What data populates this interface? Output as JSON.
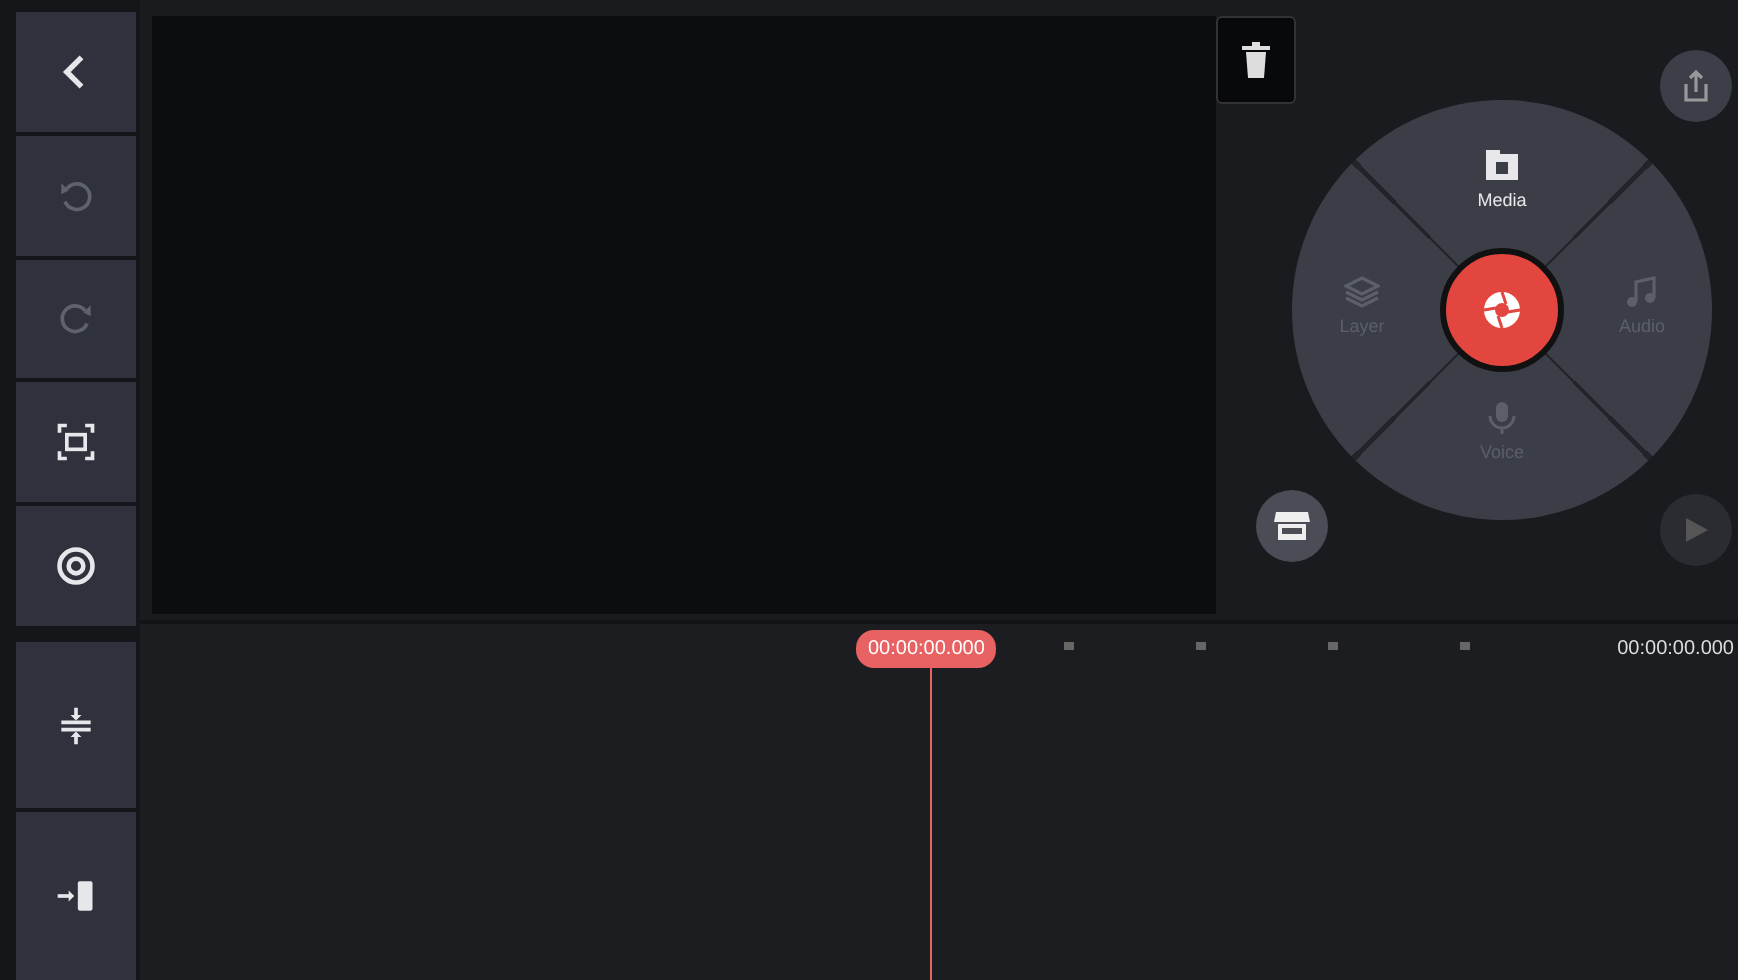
{
  "toolbar": [
    {
      "kind": "back",
      "disabled": false
    },
    {
      "kind": "undo",
      "disabled": true
    },
    {
      "kind": "redo",
      "disabled": true
    },
    {
      "kind": "fit",
      "disabled": false
    },
    {
      "kind": "settings",
      "disabled": false
    }
  ],
  "timeline_tools": [
    {
      "kind": "split"
    },
    {
      "kind": "jump"
    }
  ],
  "media_wheel": {
    "items": [
      {
        "label": "Media",
        "disabled": false
      },
      {
        "label": "Layer",
        "disabled": true
      },
      {
        "label": "Audio",
        "disabled": true
      },
      {
        "label": "Voice",
        "disabled": true
      }
    ]
  },
  "timeline": {
    "playhead_time": "00:00:00.000",
    "end_time": "00:00:00.000"
  }
}
